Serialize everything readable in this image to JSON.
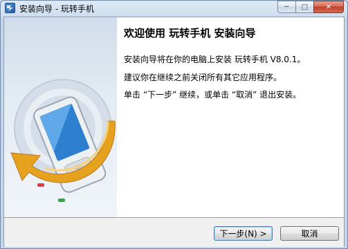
{
  "window": {
    "title": "安装向导 - 玩转手机",
    "minimize_glyph": "─",
    "maximize_glyph": "□",
    "close_glyph": "✕"
  },
  "content": {
    "heading": "欢迎使用 玩转手机 安装向导",
    "line1": "安装向导将在你的电脑上安装 玩转手机 V8.0.1。",
    "line2": "建议你在继续之前关闭所有其它应用程序。",
    "line3": "单击 “下一步” 继续，或单击 “取消” 退出安装。"
  },
  "buttons": {
    "next_label": "下一步(N) >",
    "cancel_label": "取消"
  },
  "colors": {
    "accent_arrow": "#e6a21f",
    "phone_screen": "#3a8fd6",
    "disc": "#c7d3df"
  },
  "icons": {
    "app": "installer-icon",
    "side": "phone-with-arrow-illustration"
  }
}
